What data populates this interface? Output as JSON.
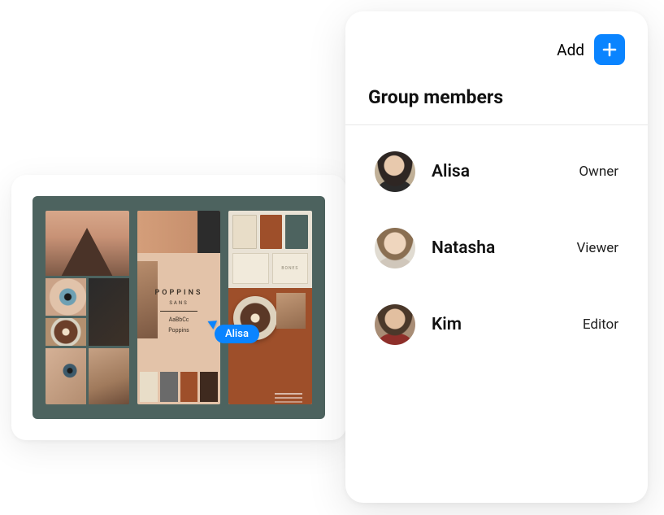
{
  "preview": {
    "brand_name": "POPPINS",
    "brand_sub": "SANS",
    "type_sample_1": "AaBbCc",
    "type_sample_2": "Poppins",
    "biz_label_1": "",
    "biz_label_2": "BONES",
    "cursor_user": "Alisa"
  },
  "panel": {
    "add_label": "Add",
    "title": "Group members",
    "members": [
      {
        "name": "Alisa",
        "role": "Owner"
      },
      {
        "name": "Natasha",
        "role": "Viewer"
      },
      {
        "name": "Kim",
        "role": "Editor"
      }
    ]
  },
  "colors": {
    "accent": "#0a84ff",
    "canvas_bg": "#4d635f",
    "swatch_cream": "#e8ddc8",
    "swatch_rust": "#9e4f2a",
    "swatch_slate": "#4d635f"
  }
}
